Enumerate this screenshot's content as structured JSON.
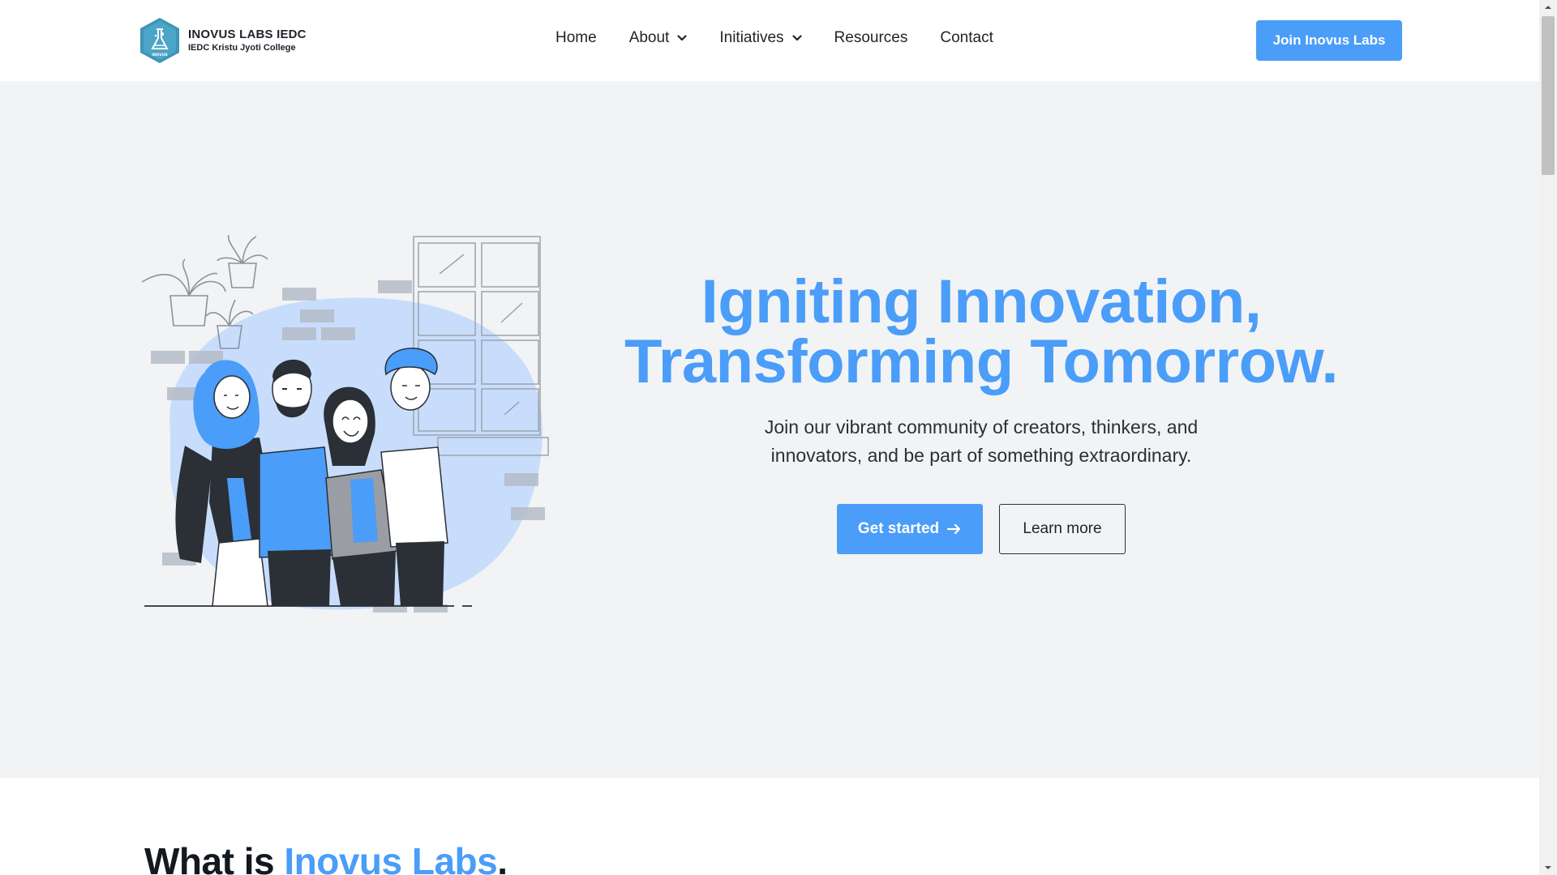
{
  "brand": {
    "name": "INOVUS LABS IEDC",
    "subtitle": "IEDC Kristu Jyoti College",
    "logo_badge": "INOVUS",
    "logo_icon": "flask-hexagon-logo",
    "accent_color": "#4a9df8"
  },
  "nav": {
    "items": [
      {
        "label": "Home",
        "has_dropdown": false
      },
      {
        "label": "About",
        "has_dropdown": true
      },
      {
        "label": "Initiatives",
        "has_dropdown": true
      },
      {
        "label": "Resources",
        "has_dropdown": false
      },
      {
        "label": "Contact",
        "has_dropdown": false
      }
    ],
    "cta_label": "Join Inovus Labs"
  },
  "hero": {
    "title_line1": "Igniting Innovation,",
    "title_line2": "Transforming Tomorrow.",
    "subtitle": "Join our vibrant community of creators, thinkers, and innovators, and be part of something extraordinary.",
    "primary_label": "Get started",
    "primary_icon": "arrow-right-icon",
    "secondary_label": "Learn more",
    "background_color": "#f2f3f5"
  },
  "next_section": {
    "title_prefix": "What is ",
    "title_accent": "Inovus Labs",
    "title_suffix": "."
  }
}
